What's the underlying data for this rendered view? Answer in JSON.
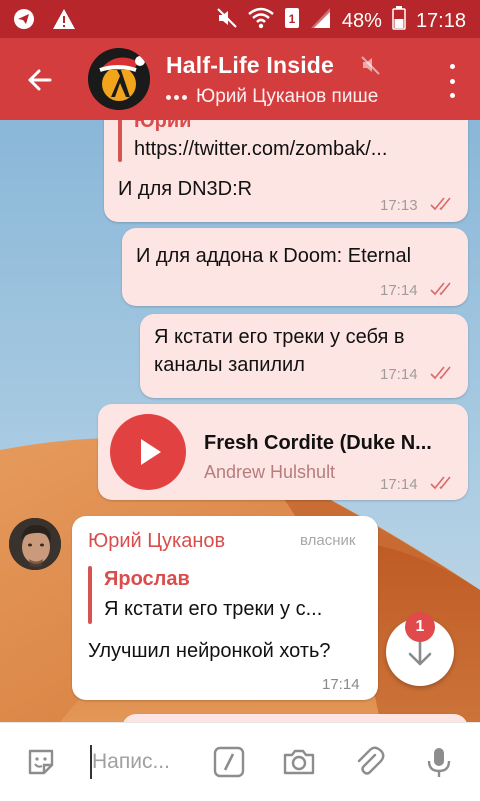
{
  "status_bar": {
    "battery": "48%",
    "time": "17:18",
    "icons": [
      "telegram-app-icon",
      "warning-icon",
      "mute-icon",
      "wifi-icon",
      "sim-1-icon",
      "signal-icon",
      "battery-icon"
    ]
  },
  "header": {
    "title": "Half-Life Inside",
    "status": "Юрий Цуканов пише",
    "colors": {
      "toolbar": "#d43d3d",
      "status_bar": "#b7262a"
    }
  },
  "messages": [
    {
      "type": "outgoing",
      "reply_name": "Юрий",
      "reply_text": "https://twitter.com/zombak/...",
      "text": "И для DN3D:R",
      "time": "17:13",
      "read": true
    },
    {
      "type": "outgoing",
      "text": "И для аддона к Doom: Eternal",
      "time": "17:14",
      "read": true
    },
    {
      "type": "outgoing",
      "text_line1": "Я кстати его треки у себя в",
      "text_line2": "каналы запилил",
      "time": "17:14",
      "read": true
    },
    {
      "type": "outgoing-audio",
      "track_title": "Fresh Cordite (Duke N...",
      "track_artist": "Andrew Hulshult",
      "time": "17:14",
      "read": true
    },
    {
      "type": "incoming",
      "sender": "Юрий Цуканов",
      "badge": "власник",
      "reply_name": "Ярослав",
      "reply_text": "Я кстати его треки у с...",
      "text": "Улучшил нейронкой хоть?",
      "time": "17:14"
    }
  ],
  "scroll_down": {
    "unread_count": "1"
  },
  "composer": {
    "placeholder": "Напис...",
    "icons": [
      "sticker-icon",
      "bot-command-icon",
      "camera-icon",
      "attach-icon",
      "microphone-icon"
    ]
  },
  "colors": {
    "accent": "#d43d3d",
    "outgoing_bubble": "#fde5e3",
    "incoming_bubble": "#ffffff"
  }
}
